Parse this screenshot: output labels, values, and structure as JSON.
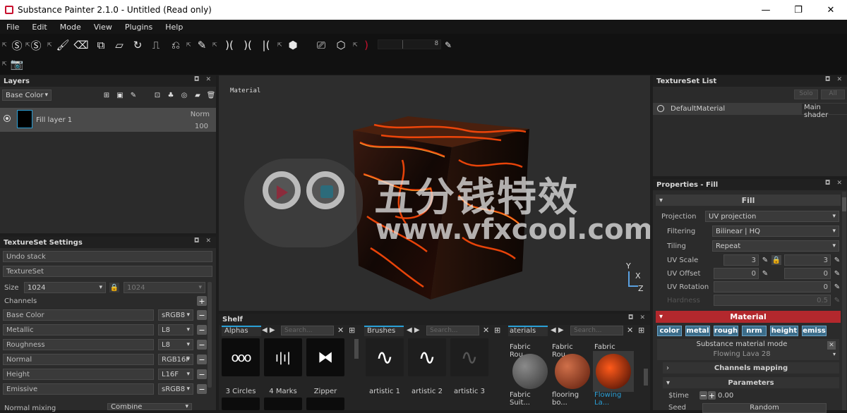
{
  "window": {
    "title": "Substance Painter 2.1.0 - Untitled (Read only)",
    "minimize": "—",
    "maximize": "❐",
    "close": "✕"
  },
  "menu": [
    "File",
    "Edit",
    "Mode",
    "View",
    "Plugins",
    "Help"
  ],
  "toolbar": {
    "slider_value": "8"
  },
  "layers": {
    "title": "Layers",
    "channel_select": "Base Color",
    "items": [
      {
        "name": "Fill layer 1",
        "blend": "Norm",
        "opacity": "100"
      }
    ]
  },
  "texture_set_settings": {
    "title": "TextureSet Settings",
    "undo_stack": "Undo stack",
    "texture_set": "TextureSet",
    "size_label": "Size",
    "size_value": "1024",
    "size_linked": "1024",
    "channels_label": "Channels",
    "channels": [
      {
        "name": "Base Color",
        "format": "sRGB8"
      },
      {
        "name": "Metallic",
        "format": "L8"
      },
      {
        "name": "Roughness",
        "format": "L8"
      },
      {
        "name": "Normal",
        "format": "RGB16F"
      },
      {
        "name": "Height",
        "format": "L16F"
      },
      {
        "name": "Emissive",
        "format": "sRGB8"
      }
    ],
    "normal_mixing_label": "Normal mixing",
    "normal_mixing_value": "Combine"
  },
  "viewport": {
    "label": "Material",
    "axis_y": "Y",
    "axis_x": "X",
    "axis_z": "Z"
  },
  "watermark": {
    "line1": "五分钱特效",
    "line2": "www.vfxcool.com"
  },
  "shelf": {
    "title": "Shelf",
    "alphas": {
      "tab": "Alphas",
      "search_placeholder": "Search...",
      "items": [
        "3 Circles",
        "4 Marks",
        "Zipper"
      ]
    },
    "brushes": {
      "tab": "Brushes",
      "search_placeholder": "Search...",
      "items": [
        "artistic 1",
        "artistic 2",
        "artistic 3"
      ]
    },
    "materials": {
      "tab": "aterials",
      "search_placeholder": "Search...",
      "items": [
        "Fabric Rou...",
        "Fabric Rou...",
        "Fabric Soft...",
        "Fabric Suit...",
        "flooring bo...",
        "Flowing La..."
      ]
    }
  },
  "textureset_list": {
    "title": "TextureSet List",
    "solo": "Solo",
    "all": "All",
    "item": "DefaultMaterial",
    "shader": "Main shader"
  },
  "properties": {
    "title": "Properties - Fill",
    "fill_header": "Fill",
    "projection_label": "Projection",
    "projection_value": "UV projection",
    "filtering_label": "Filtering",
    "filtering_value": "Bilinear | HQ",
    "tiling_label": "Tiling",
    "tiling_value": "Repeat",
    "uv_scale_label": "UV Scale",
    "uv_scale_u": "3",
    "uv_scale_v": "3",
    "uv_offset_label": "UV Offset",
    "uv_offset_u": "0",
    "uv_offset_v": "0",
    "uv_rotation_label": "UV Rotation",
    "uv_rotation_value": "0",
    "hardness_label": "Hardness",
    "hardness_value": "0.5",
    "material_header": "Material",
    "chips": [
      "color",
      "metal",
      "rough",
      "nrm",
      "height",
      "emiss"
    ],
    "mode_label": "Substance material mode",
    "mode_value": "Flowing Lava 28",
    "channels_mapping": "Channels mapping",
    "parameters": "Parameters",
    "time_label": "$time",
    "time_value": "0.00",
    "seed_label": "Seed",
    "seed_button": "Random"
  },
  "colors": {
    "accent_red": "#c8102e",
    "chip_blue": "#3c6d8a",
    "material_bar": "#b3282d"
  }
}
